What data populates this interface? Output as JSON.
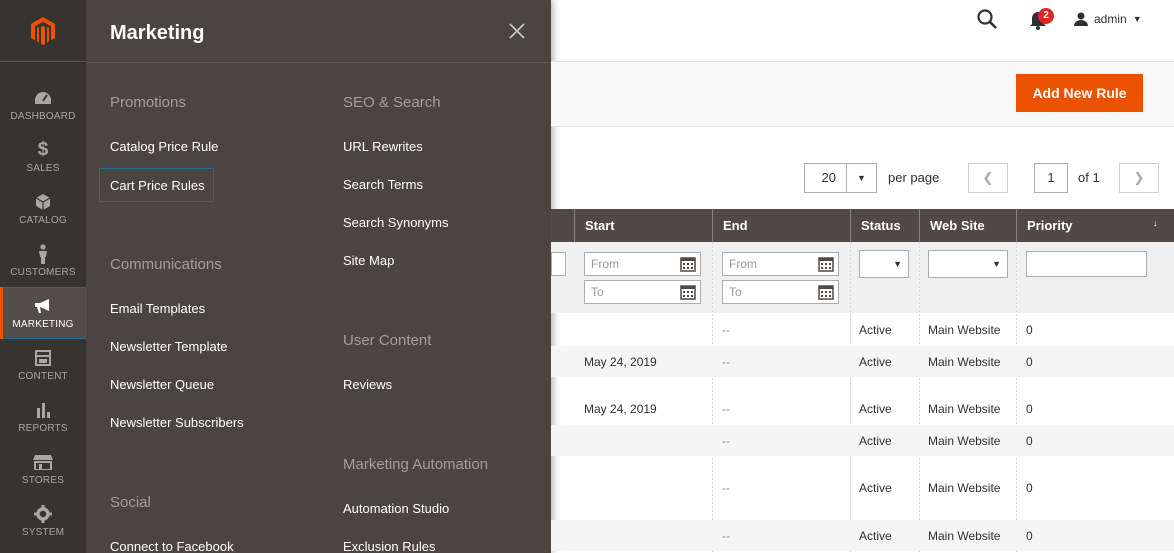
{
  "nav": {
    "items": [
      {
        "label": "DASHBOARD",
        "icon": "dashboard-icon"
      },
      {
        "label": "SALES",
        "icon": "dollar-icon"
      },
      {
        "label": "CATALOG",
        "icon": "box-icon"
      },
      {
        "label": "CUSTOMERS",
        "icon": "person-icon"
      },
      {
        "label": "MARKETING",
        "icon": "megaphone-icon",
        "active": true
      },
      {
        "label": "CONTENT",
        "icon": "layout-icon"
      },
      {
        "label": "REPORTS",
        "icon": "bar-chart-icon"
      },
      {
        "label": "STORES",
        "icon": "store-icon"
      },
      {
        "label": "SYSTEM",
        "icon": "gear-icon"
      }
    ]
  },
  "flyout": {
    "title": "Marketing",
    "left_column": {
      "promotions": {
        "heading": "Promotions",
        "links": [
          "Catalog Price Rule",
          "Cart Price Rules"
        ]
      },
      "communications": {
        "heading": "Communications",
        "links": [
          "Email Templates",
          "Newsletter Template",
          "Newsletter Queue",
          "Newsletter Subscribers"
        ]
      },
      "social": {
        "heading": "Social",
        "links": [
          "Connect to Facebook"
        ]
      }
    },
    "right_column": {
      "seo": {
        "heading": "SEO & Search",
        "links": [
          "URL Rewrites",
          "Search Terms",
          "Search Synonyms",
          "Site Map"
        ]
      },
      "user_content": {
        "heading": "User Content",
        "links": [
          "Reviews"
        ]
      },
      "automation": {
        "heading": "Marketing Automation",
        "links": [
          "Automation Studio",
          "Exclusion Rules"
        ]
      }
    }
  },
  "header": {
    "user": "admin",
    "notification_count": "2"
  },
  "toolbar": {
    "add_label": "Add New Rule"
  },
  "pager": {
    "per_page_value": "20",
    "per_page_label": "per page",
    "current_page": "1",
    "of_label": "of 1"
  },
  "grid": {
    "columns": [
      "Start",
      "End",
      "Status",
      "Web Site",
      "Priority"
    ],
    "filters": {
      "from_placeholder": "From",
      "to_placeholder": "To"
    },
    "rows": [
      {
        "start": "",
        "end": "--",
        "status": "Active",
        "website": "Main Website",
        "priority": "0"
      },
      {
        "start": "May 24, 2019",
        "end": "--",
        "status": "Active",
        "website": "Main Website",
        "priority": "0"
      },
      {
        "start": "May 24, 2019",
        "end": "--",
        "status": "Active",
        "website": "Main Website",
        "priority": "0"
      },
      {
        "start": "",
        "end": "--",
        "status": "Active",
        "website": "Main Website",
        "priority": "0"
      },
      {
        "start": "",
        "end": "--",
        "status": "Active",
        "website": "Main Website",
        "priority": "0"
      },
      {
        "start": "",
        "end": "--",
        "status": "Active",
        "website": "Main Website",
        "priority": "0"
      }
    ]
  },
  "colors": {
    "accent": "#eb5202",
    "nav_bg": "#373330",
    "flyout_bg": "#4a4542",
    "header_bg": "#514943",
    "focus": "#1e6d8e"
  }
}
